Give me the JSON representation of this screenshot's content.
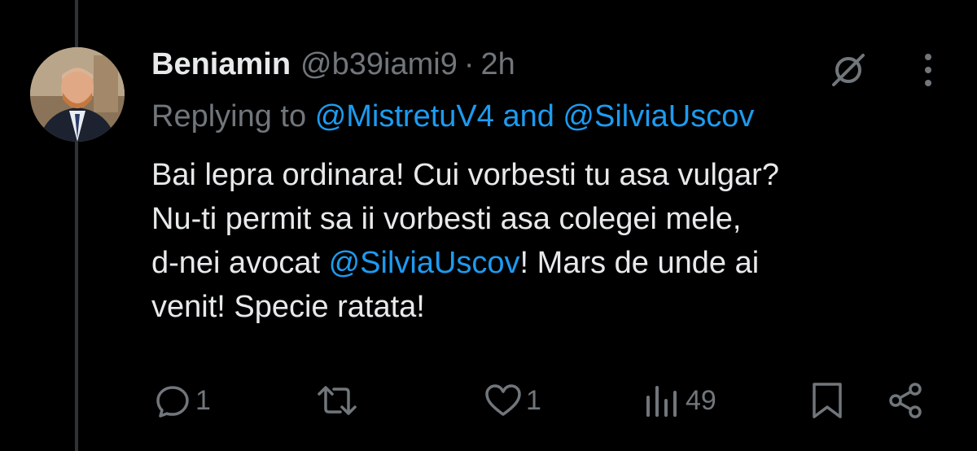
{
  "tweet": {
    "display_name": "Beniamin",
    "handle": "@b39iami9",
    "separator": "·",
    "time": "2h",
    "reply_prefix": "Replying to",
    "reply_mention_1": "@MistretuV4",
    "reply_and": "and",
    "reply_mention_2": "@SilviaUscov",
    "text_line_1": "Bai lepra ordinara! Cui vorbesti tu asa vulgar?",
    "text_line_2": "Nu-ti permit sa ii vorbesti asa colegei mele,",
    "text_line_3_pre": "d-nei avocat",
    "text_line_3_mention": "@SilviaUscov",
    "text_line_3_post": "! Mars de unde ai",
    "text_line_4": "venit! Specie ratata!"
  },
  "actions": {
    "reply_count": "1",
    "retweet_count": "",
    "like_count": "1",
    "views_count": "49"
  },
  "icons": {
    "grok": "grok-icon",
    "more": "more-vertical-icon",
    "reply": "reply-bubble-icon",
    "retweet": "retweet-icon",
    "like": "heart-icon",
    "views": "views-bar-chart-icon",
    "bookmark": "bookmark-icon",
    "share": "share-icon"
  },
  "colors": {
    "background": "#000000",
    "text": "#e7e9ea",
    "muted": "#71767b",
    "link": "#1d9bf0",
    "thread_line": "#2f3336"
  }
}
